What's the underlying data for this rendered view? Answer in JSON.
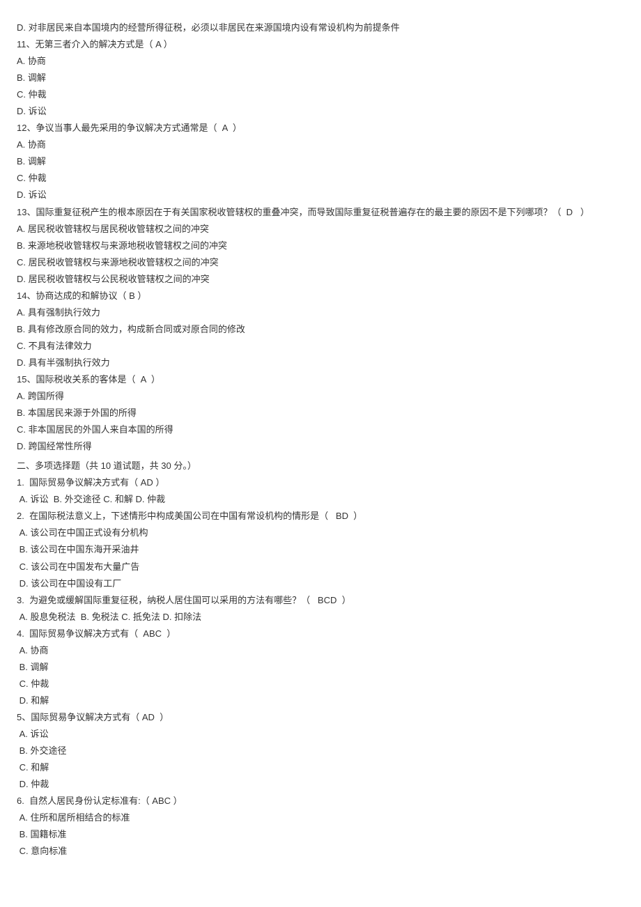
{
  "s1": {
    "q10": {
      "D": "D. 对非居民来自本国境内的经营所得征税，必须以非居民在来源国境内设有常设机构为前提条件"
    },
    "q11": {
      "stem": "11、无第三者介入的解决方式是（ A ）",
      "A": "A. 协商",
      "B": "B. 调解",
      "C": "C. 仲裁",
      "D": "D. 诉讼"
    },
    "q12": {
      "stem": "12、争议当事人最先采用的争议解决方式通常是（  A  ）",
      "A": "A. 协商",
      "B": "B. 调解",
      "C": "C. 仲裁",
      "D": "D. 诉讼"
    },
    "q13": {
      "stem": "13、国际重复征税产生的根本原因在于有关国家税收管辖权的重叠冲突，而导致国际重复征税普遍存在的最主要的原因不是下列哪项？（  D   ）",
      "A": "A. 居民税收管辖权与居民税收管辖权之间的冲突",
      "B": "B. 来源地税收管辖权与来源地税收管辖权之间的冲突",
      "C": "C. 居民税收管辖权与来源地税收管辖权之间的冲突",
      "D": "D. 居民税收管辖权与公民税收管辖权之间的冲突"
    },
    "q14": {
      "stem": "14、协商达成的和解协议（ B ）",
      "A": "A. 具有强制执行效力",
      "B": "B. 具有修改原合同的效力，构成新合同或对原合同的修改",
      "C": "C. 不具有法律效力",
      "D": "D. 具有半强制执行效力"
    },
    "q15": {
      "stem": "15、国际税收关系的客体是（  A  ）",
      "A": "A. 跨国所得",
      "B": "B. 本国居民来源于外国的所得",
      "C": "C. 非本国居民的外国人来自本国的所得",
      "D": "D. 跨国经常性所得"
    }
  },
  "s2": {
    "heading": "二、多项选择题（共 10 道试题，共 30 分。）",
    "q1": {
      "stem": "1.  国际贸易争议解决方式有（ AD ）",
      "line": " A. 诉讼  B. 外交途径 C. 和解 D. 仲裁"
    },
    "q2": {
      "stem": "2.  在国际税法意义上，下述情形中构成美国公司在中国有常设机构的情形是（   BD  ）",
      "A": " A. 该公司在中国正式设有分机构",
      "B": " B. 该公司在中国东海开采油井",
      "C": " C. 该公司在中国发布大量广告",
      "D": " D. 该公司在中国设有工厂"
    },
    "q3": {
      "stem": "3.  为避免或缓解国际重复征税，纳税人居住国可以采用的方法有哪些？（   BCD  ）",
      "line": " A. 股息免税法  B. 免税法 C. 抵免法 D. 扣除法"
    },
    "q4": {
      "stem": "4.  国际贸易争议解决方式有（  ABC  ）",
      "A": " A. 协商",
      "B": " B. 调解",
      "C": " C. 仲裁",
      "D": " D. 和解"
    },
    "q5": {
      "stem": "5、国际贸易争议解决方式有（ AD  ）",
      "A": " A. 诉讼",
      "B": " B. 外交途径",
      "C": " C. 和解",
      "D": " D. 仲裁"
    },
    "q6": {
      "stem": "6.  自然人居民身份认定标准有:（ ABC ）",
      "A": " A. 住所和居所相结合的标准",
      "B": " B. 国籍标准",
      "C": " C. 意向标准"
    }
  }
}
